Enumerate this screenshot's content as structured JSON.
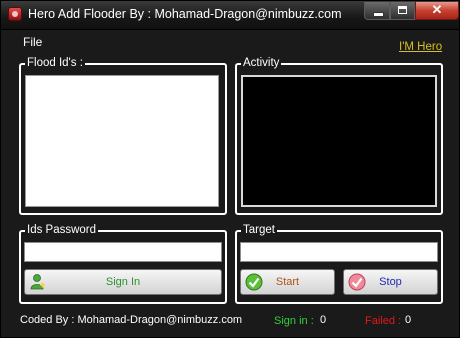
{
  "window": {
    "title": "Hero Add Flooder By : Mohamad-Dragon@nimbuzz.com",
    "controls": [
      "minimize",
      "maximize",
      "close"
    ]
  },
  "menu": {
    "file": "File",
    "link": "I'M Hero"
  },
  "groups": {
    "flood_ids": {
      "label": "Flood Id's :"
    },
    "activity": {
      "label": "Activity"
    },
    "ids_password": {
      "label": "Ids Password",
      "value": "",
      "button": "Sign In"
    },
    "target": {
      "label": "Target",
      "value": "",
      "start": "Start",
      "stop": "Stop"
    }
  },
  "footer": {
    "coded_by": "Coded By : Mohamad-Dragon@nimbuzz.com",
    "signin_label": "Sign in :",
    "signin_count": "0",
    "failed_label": "Failed :",
    "failed_count": "0"
  },
  "colors": {
    "background": "#1a1a1a",
    "link": "#d8c020",
    "signin": "#2fd23a",
    "failed": "#e01818",
    "signin_text": "#2f8f2f",
    "start_text": "#b0521a",
    "stop_text": "#1e2bb0"
  },
  "icons": {
    "app": "app-icon",
    "signin": "user-icon",
    "start": "check-circle-icon",
    "stop": "cancel-circle-icon"
  }
}
